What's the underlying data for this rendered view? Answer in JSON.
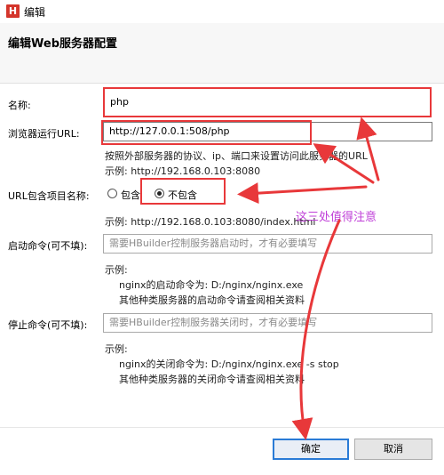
{
  "window": {
    "title": "编辑",
    "app_icon_letter": "H"
  },
  "header": {
    "title": "编辑Web服务器配置"
  },
  "form": {
    "name": {
      "label": "名称:",
      "value": "php"
    },
    "url": {
      "label": "浏览器运行URL:",
      "value": "http://127.0.0.1:508/php",
      "hint": "按照外部服务器的协议、ip、端口来设置访问此服务器的URL",
      "example": "示例:    http://192.168.0.103:8080"
    },
    "url_include": {
      "label": "URL包含项目名称:",
      "option_include": "包含",
      "option_exclude": "不包含",
      "selected": "不包含",
      "example": "示例:    http://192.168.0.103:8080/index.html"
    },
    "start_cmd": {
      "label": "启动命令(可不填):",
      "placeholder": "需要HBuilder控制服务器启动时，才有必要填写",
      "example_title": "示例:",
      "example_line1": "nginx的启动命令为:  D:/nginx/nginx.exe",
      "example_line2": "其他种类服务器的启动命令请查阅相关资料"
    },
    "stop_cmd": {
      "label": "停止命令(可不填):",
      "placeholder": "需要HBuilder控制服务器关闭时，才有必要填写",
      "example_title": "示例:",
      "example_line1": "nginx的关闭命令为:  D:/nginx/nginx.exe -s stop",
      "example_line2": "其他种类服务器的关闭命令请查阅相关资料"
    }
  },
  "annotation": {
    "text": "这三处值得注意",
    "color": "#c040d8"
  },
  "buttons": {
    "ok": "确定",
    "cancel": "取消"
  },
  "colors": {
    "annotation_red": "#e8383a",
    "primary_border": "#2a7bd6"
  }
}
